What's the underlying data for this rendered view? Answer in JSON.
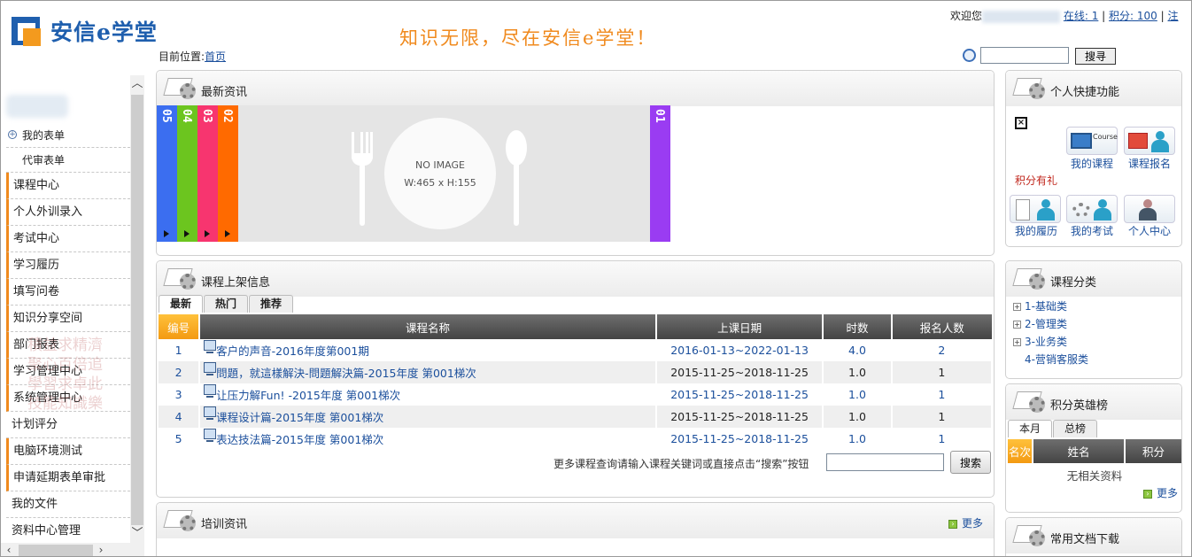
{
  "header": {
    "logo_text": "安信e学堂",
    "slogan": "知识无限，尽在安信e学堂！",
    "welcome": "欢迎您",
    "online": "在线: 1",
    "points": "积分: 100",
    "logout": "注",
    "sep": "|"
  },
  "breadcrumb": {
    "label": "目前位置:",
    "home": "首页"
  },
  "top_search": {
    "button": "搜寻",
    "value": ""
  },
  "sidebar": {
    "items": [
      {
        "label": "我的表单",
        "kind": "plus"
      },
      {
        "label": "代审表单",
        "kind": "sub"
      },
      {
        "label": "课程中心",
        "kind": "bar"
      },
      {
        "label": "个人外训录入",
        "kind": "bar"
      },
      {
        "label": "考试中心",
        "kind": "bar"
      },
      {
        "label": "学习履历",
        "kind": "bar"
      },
      {
        "label": "填写问卷",
        "kind": "bar"
      },
      {
        "label": "知识分享空间",
        "kind": "bar"
      },
      {
        "label": "部门报表",
        "kind": "bar"
      },
      {
        "label": "学习管理中心",
        "kind": "bar"
      },
      {
        "label": "系统管理中心",
        "kind": "bar"
      },
      {
        "label": "计划评分",
        "kind": "plain"
      },
      {
        "label": "电脑环境测试",
        "kind": "bar"
      },
      {
        "label": "申请延期表单审批",
        "kind": "bar"
      },
      {
        "label": "我的文件",
        "kind": "plain"
      },
      {
        "label": "资料中心管理",
        "kind": "plain"
      }
    ]
  },
  "news": {
    "title": "最新资讯",
    "tabs": [
      {
        "num": "05",
        "color": "#3b6ef0"
      },
      {
        "num": "04",
        "color": "#6cc51f"
      },
      {
        "num": "03",
        "color": "#f7356f"
      },
      {
        "num": "02",
        "color": "#ff6a00"
      },
      {
        "num": "01",
        "color": "#9a3cf2"
      }
    ],
    "placeholder_line1": "NO IMAGE",
    "placeholder_line2": "W:465 x H:155"
  },
  "courses": {
    "title": "课程上架信息",
    "tabs": [
      "最新",
      "热门",
      "推荐"
    ],
    "headers": [
      "编号",
      "课程名称",
      "上课日期",
      "时数",
      "报名人数"
    ],
    "rows": [
      {
        "id": "1",
        "name": "客户的声音-2016年度第001期",
        "date": "2016-01-13~2022-01-13",
        "hours": "4.0",
        "count": "2"
      },
      {
        "id": "2",
        "name": "問題，就這樣解決-問題解決篇-2015年度 第001梯次",
        "date": "2015-11-25~2018-11-25",
        "hours": "1.0",
        "count": "1"
      },
      {
        "id": "3",
        "name": "让压力解Fun! -2015年度 第001梯次",
        "date": "2015-11-25~2018-11-25",
        "hours": "1.0",
        "count": "1"
      },
      {
        "id": "4",
        "name": "课程设计篇-2015年度 第001梯次",
        "date": "2015-11-25~2018-11-25",
        "hours": "1.0",
        "count": "1"
      },
      {
        "id": "5",
        "name": "表达技法篇-2015年度 第001梯次",
        "date": "2015-11-25~2018-11-25",
        "hours": "1.0",
        "count": "1"
      }
    ],
    "more_hint": "更多课程查询请输入课程关键词或直接点击“搜索”按钮",
    "search_button": "搜索"
  },
  "training": {
    "title": "培训资讯",
    "more": "更多"
  },
  "quick": {
    "title": "个人快捷功能",
    "icon_badge": "Course",
    "items_row1": [
      "我的课程",
      "课程报名"
    ],
    "points_gift": "积分有礼",
    "items_row2": [
      "我的履历",
      "我的考试",
      "个人中心"
    ]
  },
  "categories": {
    "title": "课程分类",
    "items": [
      {
        "label": "1-基础类",
        "expandable": true
      },
      {
        "label": "2-管理类",
        "expandable": true
      },
      {
        "label": "3-业务类",
        "expandable": true
      },
      {
        "label": "4-营销客服类",
        "expandable": false
      }
    ]
  },
  "ranking": {
    "title": "积分英雄榜",
    "tabs": [
      "本月",
      "总榜"
    ],
    "headers": [
      "名次",
      "姓名",
      "积分"
    ],
    "empty": "无相关资料",
    "more": "更多"
  },
  "docs": {
    "title": "常用文档下载"
  },
  "colors": {
    "accent": "#f39a12",
    "link": "#1b4f9c",
    "logo_blue": "#1f5fae",
    "logo_orange": "#f39a1e"
  }
}
